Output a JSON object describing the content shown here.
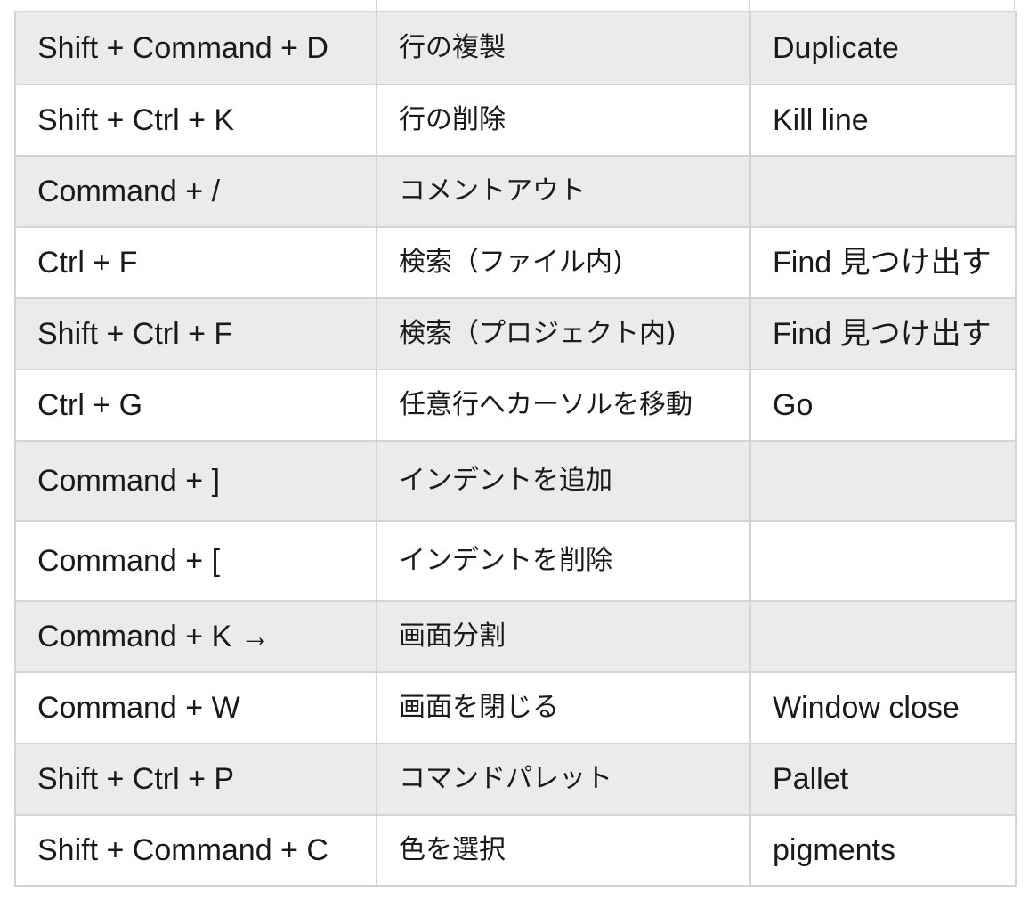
{
  "table": {
    "rows": [
      {
        "shortcut": "Shift + Command + D",
        "description_ja": "行の複製",
        "mnemonic_en": "Duplicate"
      },
      {
        "shortcut": "Shift + Ctrl + K",
        "description_ja": "行の削除",
        "mnemonic_en": "Kill line"
      },
      {
        "shortcut": "Command + /",
        "description_ja": "コメントアウト",
        "mnemonic_en": ""
      },
      {
        "shortcut": "Ctrl + F",
        "description_ja": "検索（ファイル内)",
        "mnemonic_en": "Find 見つけ出す"
      },
      {
        "shortcut": "Shift + Ctrl + F",
        "description_ja": "検索（プロジェクト内)",
        "mnemonic_en": "Find 見つけ出す"
      },
      {
        "shortcut": "Ctrl + G",
        "description_ja": "任意行へカーソルを移動",
        "mnemonic_en": "Go"
      },
      {
        "shortcut": "Command + ]",
        "description_ja": "インデントを追加",
        "mnemonic_en": ""
      },
      {
        "shortcut": "Command + [",
        "description_ja": "インデントを削除",
        "mnemonic_en": ""
      },
      {
        "shortcut": "Command + K →",
        "description_ja": "画面分割",
        "mnemonic_en": ""
      },
      {
        "shortcut": "Command + W",
        "description_ja": "画面を閉じる",
        "mnemonic_en": "Window close"
      },
      {
        "shortcut": "Shift + Ctrl + P",
        "description_ja": "コマンドパレット",
        "mnemonic_en": "Pallet"
      },
      {
        "shortcut": "Shift + Command + C",
        "description_ja": "色を選択",
        "mnemonic_en": "pigments"
      }
    ]
  }
}
